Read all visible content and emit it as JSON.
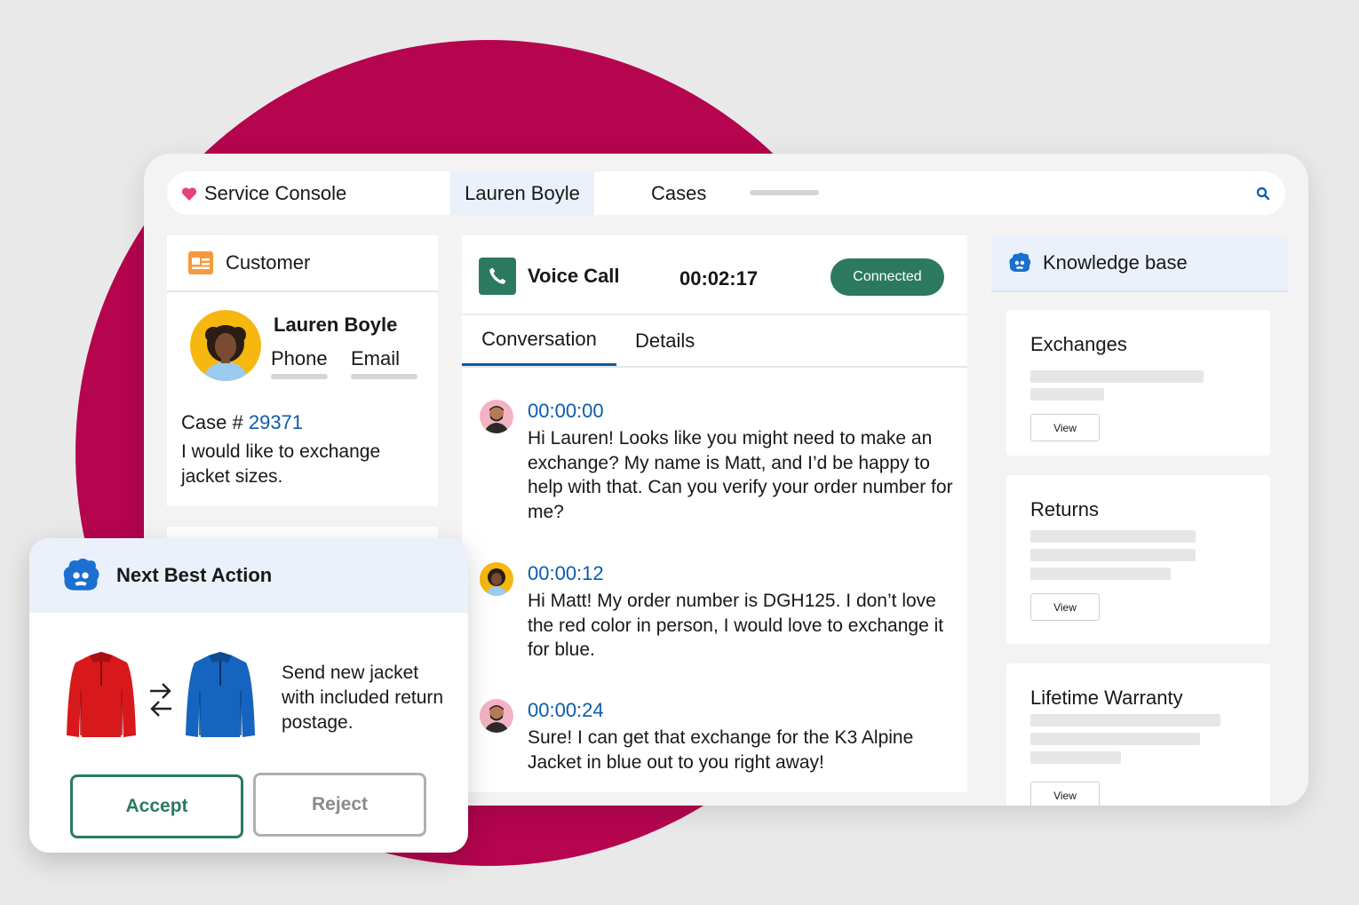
{
  "header": {
    "app_title": "Service Console",
    "tabs": [
      {
        "label": "Lauren Boyle",
        "active": true
      },
      {
        "label": "Cases",
        "active": false
      }
    ]
  },
  "customer": {
    "panel_title": "Customer",
    "name": "Lauren Boyle",
    "phone_label": "Phone",
    "email_label": "Email",
    "case_prefix": "Case #",
    "case_number": "29371",
    "case_description": "I would like to exchange jacket sizes."
  },
  "call": {
    "title": "Voice Call",
    "timer": "00:02:17",
    "status": "Connected",
    "tabs": [
      "Conversation",
      "Details"
    ],
    "messages": [
      {
        "speaker": "agent",
        "time": "00:00:00",
        "text": "Hi Lauren! Looks like you might need to make an exchange? My name is Matt, and I’d be happy to help with that. Can you verify your order number for me?"
      },
      {
        "speaker": "customer",
        "time": "00:00:12",
        "text": "Hi Matt! My order number is DGH125. I don’t love the red color in person, I would love to exchange it for blue."
      },
      {
        "speaker": "agent",
        "time": "00:00:24",
        "text": "Sure! I can get that exchange for the K3 Alpine Jacket in blue out to you right away!"
      }
    ]
  },
  "knowledge": {
    "title": "Knowledge base",
    "items": [
      {
        "title": "Exchanges",
        "button": "View"
      },
      {
        "title": "Returns",
        "button": "View"
      },
      {
        "title": "Lifetime Warranty",
        "button": "View"
      }
    ]
  },
  "nba": {
    "title": "Next Best Action",
    "text": "Send new jacket with included return postage.",
    "accept": "Accept",
    "reject": "Reject"
  },
  "colors": {
    "brand_circle": "#b5054f",
    "accent_green": "#2b7a5f",
    "link_blue": "#0b5cab",
    "header_tint": "#eaf1fb"
  },
  "icons": [
    "heart-icon",
    "search-icon",
    "contact-card-icon",
    "phone-icon",
    "einstein-icon",
    "swap-arrows-icon"
  ]
}
